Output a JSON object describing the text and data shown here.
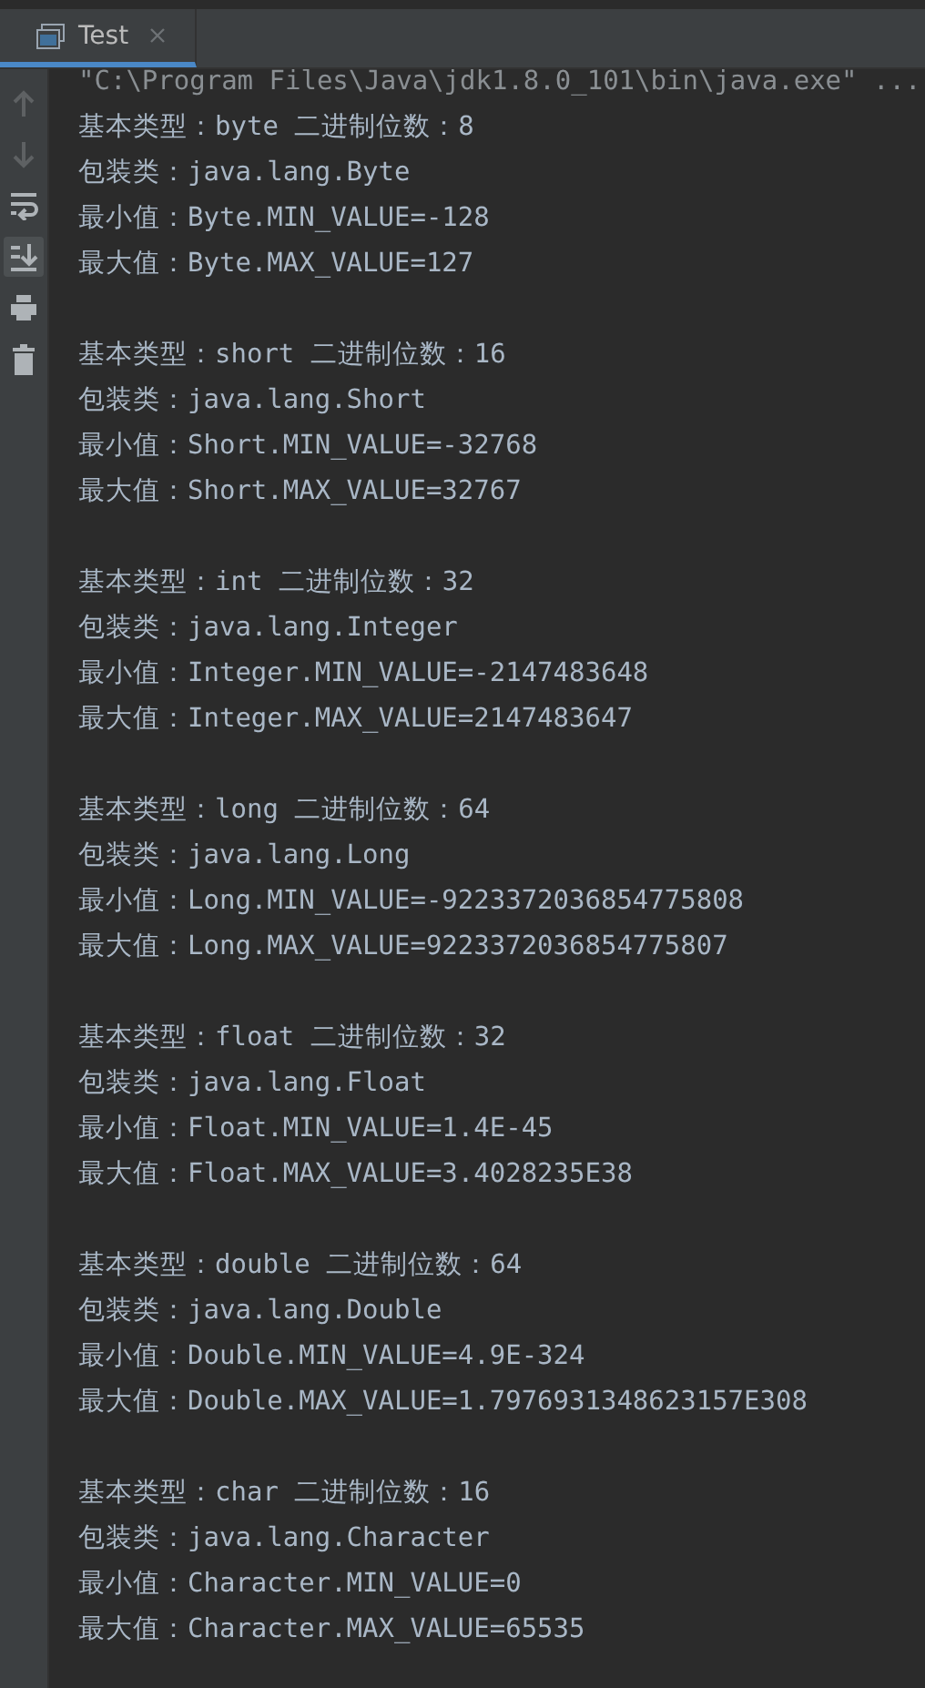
{
  "tabs": [
    {
      "label": "Test",
      "selected": true
    }
  ],
  "command_line": "\"C:\\Program Files\\Java\\jdk1.8.0_101\\bin\\java.exe\" ...",
  "toolbar": [
    {
      "kind": "up",
      "disabled": true,
      "selected": false
    },
    {
      "kind": "down",
      "disabled": true,
      "selected": false
    },
    {
      "kind": "wrap",
      "disabled": false,
      "selected": false
    },
    {
      "kind": "scroll-end",
      "disabled": false,
      "selected": true
    },
    {
      "kind": "print",
      "disabled": false,
      "selected": false
    },
    {
      "kind": "trash",
      "disabled": false,
      "selected": false
    }
  ],
  "output": [
    {
      "lines": [
        "基本类型：byte 二进制位数：8",
        "包装类：java.lang.Byte",
        "最小值：Byte.MIN_VALUE=-128",
        "最大值：Byte.MAX_VALUE=127"
      ]
    },
    {
      "lines": [
        "基本类型：short 二进制位数：16",
        "包装类：java.lang.Short",
        "最小值：Short.MIN_VALUE=-32768",
        "最大值：Short.MAX_VALUE=32767"
      ]
    },
    {
      "lines": [
        "基本类型：int 二进制位数：32",
        "包装类：java.lang.Integer",
        "最小值：Integer.MIN_VALUE=-2147483648",
        "最大值：Integer.MAX_VALUE=2147483647"
      ]
    },
    {
      "lines": [
        "基本类型：long 二进制位数：64",
        "包装类：java.lang.Long",
        "最小值：Long.MIN_VALUE=-9223372036854775808",
        "最大值：Long.MAX_VALUE=9223372036854775807"
      ]
    },
    {
      "lines": [
        "基本类型：float 二进制位数：32",
        "包装类：java.lang.Float",
        "最小值：Float.MIN_VALUE=1.4E-45",
        "最大值：Float.MAX_VALUE=3.4028235E38"
      ]
    },
    {
      "lines": [
        "基本类型：double 二进制位数：64",
        "包装类：java.lang.Double",
        "最小值：Double.MIN_VALUE=4.9E-324",
        "最大值：Double.MAX_VALUE=1.7976931348623157E308"
      ]
    },
    {
      "lines": [
        "基本类型：char 二进制位数：16",
        "包装类：java.lang.Character",
        "最小值：Character.MIN_VALUE=0",
        "最大值：Character.MAX_VALUE=65535"
      ]
    }
  ]
}
